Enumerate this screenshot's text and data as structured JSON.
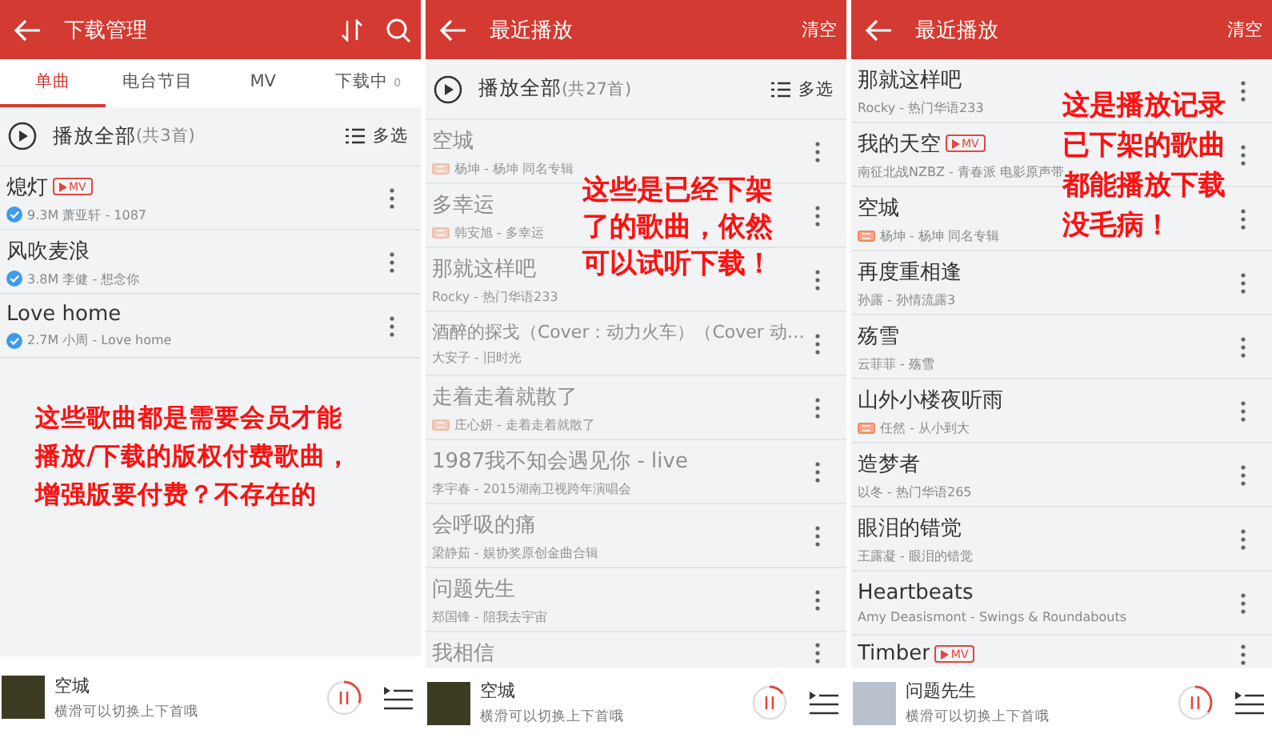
{
  "panels": [
    {
      "header": {
        "title": "下载管理",
        "actions": [
          {
            "kind": "sort"
          },
          {
            "kind": "search"
          }
        ]
      },
      "tabs": [
        {
          "label": "单曲",
          "selected": true
        },
        {
          "label": "电台节目",
          "selected": false
        },
        {
          "label": "MV",
          "selected": false
        },
        {
          "label": "下载中",
          "count": "0",
          "selected": false
        }
      ],
      "play_all": {
        "label": "播放全部",
        "count": "(共3首)",
        "multi": "多选"
      },
      "songs": [
        {
          "title": "熄灯",
          "mv_badge": "MV",
          "downloaded": true,
          "disabled": false,
          "subtitle": "9.3M 萧亚轩 - 1087"
        },
        {
          "title": "风吹麦浪",
          "downloaded": true,
          "disabled": false,
          "subtitle": "3.8M 李健 - 想念你"
        },
        {
          "title": "Love home",
          "downloaded": true,
          "disabled": false,
          "subtitle": "2.7M 小周 - Love home"
        }
      ],
      "note": "这些歌曲都是需要会员才能播放/下载的版权付费歌曲，增强版要付费？不存在的",
      "player": {
        "title": "空城",
        "hint": "横滑可以切换上下首哦",
        "level": 0.3
      }
    },
    {
      "header": {
        "title": "最近播放",
        "actions": [
          {
            "kind": "text",
            "label": "清空"
          }
        ]
      },
      "play_all": {
        "label": "播放全部",
        "count": "(共27首)",
        "multi": "多选"
      },
      "songs": [
        {
          "title": "空城",
          "hq": true,
          "disabled": true,
          "subtitle": "杨坤 - 杨坤 同名专辑"
        },
        {
          "title": "多幸运",
          "hq": true,
          "disabled": true,
          "subtitle": "韩安旭 - 多幸运"
        },
        {
          "title": "那就这样吧",
          "disabled": true,
          "subtitle": "Rocky - 热门华语233"
        },
        {
          "title": "酒醉的探戈（Cover：动力火车）（Cover 动…",
          "disabled": true,
          "subtitle": "大安子 - 旧时光"
        },
        {
          "title": "走着走着就散了",
          "hq": true,
          "disabled": true,
          "subtitle": "庄心妍 - 走着走着就散了"
        },
        {
          "title": "1987我不知会遇见你 - live",
          "disabled": true,
          "subtitle": "李宇春 - 2015湖南卫视跨年演唱会"
        },
        {
          "title": "会呼吸的痛",
          "disabled": true,
          "subtitle": "梁静茹 - 娱协奖原创金曲合辑"
        },
        {
          "title": "问题先生",
          "disabled": true,
          "subtitle": "郑国锋 - 陪我去宇宙"
        },
        {
          "title": "我相信",
          "disabled": true
        }
      ],
      "note": "这些是已经下架了的歌曲，依然可以试听下载！",
      "player": {
        "title": "空城",
        "hint": "横滑可以切换上下首哦",
        "level": 0.15
      }
    },
    {
      "header": {
        "title": "最近播放",
        "actions": [
          {
            "kind": "text",
            "label": "清空"
          }
        ]
      },
      "songs": [
        {
          "title": "那就这样吧",
          "disabled": false,
          "subtitle": "Rocky - 热门华语233"
        },
        {
          "title": "我的天空",
          "mv_badge": "MV",
          "disabled": false,
          "subtitle": "南征北战NZBZ - 青春派 电影原声带"
        },
        {
          "title": "空城",
          "hq": true,
          "disabled": false,
          "subtitle": "杨坤 - 杨坤 同名专辑"
        },
        {
          "title": "再度重相逢",
          "disabled": false,
          "subtitle": "孙露 - 孙情流露3"
        },
        {
          "title": "殇雪",
          "disabled": false,
          "subtitle": "云菲菲 - 殇雪"
        },
        {
          "title": "山外小楼夜听雨",
          "hq": true,
          "disabled": false,
          "subtitle": "任然 - 从小到大"
        },
        {
          "title": "造梦者",
          "disabled": false,
          "subtitle": "以冬 - 热门华语265"
        },
        {
          "title": "眼泪的错觉",
          "disabled": false,
          "subtitle": "王露凝 - 眼泪的错觉"
        },
        {
          "title": "Heartbeats",
          "disabled": false,
          "subtitle": "Amy Deasismont - Swings & Roundabouts"
        },
        {
          "title": "Timber",
          "mv_badge": "MV",
          "disabled": false
        }
      ],
      "note": "这是播放记录已下架的歌曲都能播放下载没毛病！",
      "player": {
        "title": "问题先生",
        "hint": "横滑可以切换上下首哦",
        "level": 0.35
      }
    }
  ]
}
